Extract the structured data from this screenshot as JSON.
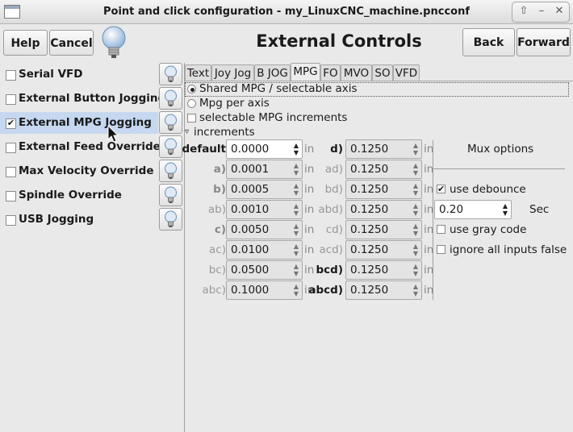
{
  "window": {
    "title": "Point and click configuration - my_LinuxCNC_machine.pncconf",
    "buttons": [
      "⇧",
      "–",
      "✕"
    ]
  },
  "toolbar": {
    "help": "Help",
    "cancel": "Cancel",
    "heading": "External Controls",
    "back": "Back",
    "forward": "Forward"
  },
  "options": [
    {
      "label": "Serial VFD",
      "checked": false
    },
    {
      "label": "External Button Jogging",
      "checked": false
    },
    {
      "label": "External MPG Jogging",
      "checked": true
    },
    {
      "label": "External Feed Override",
      "checked": false
    },
    {
      "label": "Max Velocity Override",
      "checked": false
    },
    {
      "label": "Spindle Override",
      "checked": false
    },
    {
      "label": "USB Jogging",
      "checked": false
    }
  ],
  "tabs": [
    "Text",
    "Joy Jog",
    "B JOG",
    "MPG",
    "FO",
    "MVO",
    "SO",
    "VFD"
  ],
  "active_tab": "MPG",
  "mpg": {
    "shared_label": "Shared MPG / selectable axis",
    "per_axis_label": "Mpg per axis",
    "selectable_label": "selectable MPG increments",
    "increments_label": "increments",
    "unit": "in",
    "left_rows": [
      {
        "label": "default",
        "value": "0.0000"
      },
      {
        "label": "a)",
        "value": "0.0001"
      },
      {
        "label": "b)",
        "value": "0.0005"
      },
      {
        "label": "ab)",
        "value": "0.0010"
      },
      {
        "label": "c)",
        "value": "0.0050"
      },
      {
        "label": "ac)",
        "value": "0.0100"
      },
      {
        "label": "bc)",
        "value": "0.0500"
      },
      {
        "label": "abc)",
        "value": "0.1000"
      }
    ],
    "right_rows": [
      {
        "label": "d)",
        "value": "0.1250"
      },
      {
        "label": "ad)",
        "value": "0.1250"
      },
      {
        "label": "bd)",
        "value": "0.1250"
      },
      {
        "label": "abd)",
        "value": "0.1250"
      },
      {
        "label": "cd)",
        "value": "0.1250"
      },
      {
        "label": "acd)",
        "value": "0.1250"
      },
      {
        "label": "bcd)",
        "value": "0.1250"
      },
      {
        "label": "abcd)",
        "value": "0.1250"
      }
    ],
    "mux": {
      "title": "Mux options",
      "debounce_label": "use debounce",
      "debounce_checked": true,
      "debounce_value": "0.20",
      "debounce_unit": "Sec",
      "gray_label": "use gray code",
      "ignore_label": "ignore all inputs false"
    }
  },
  "colors": {
    "selection": "#c6d8f0",
    "background": "#e9e9e9"
  }
}
